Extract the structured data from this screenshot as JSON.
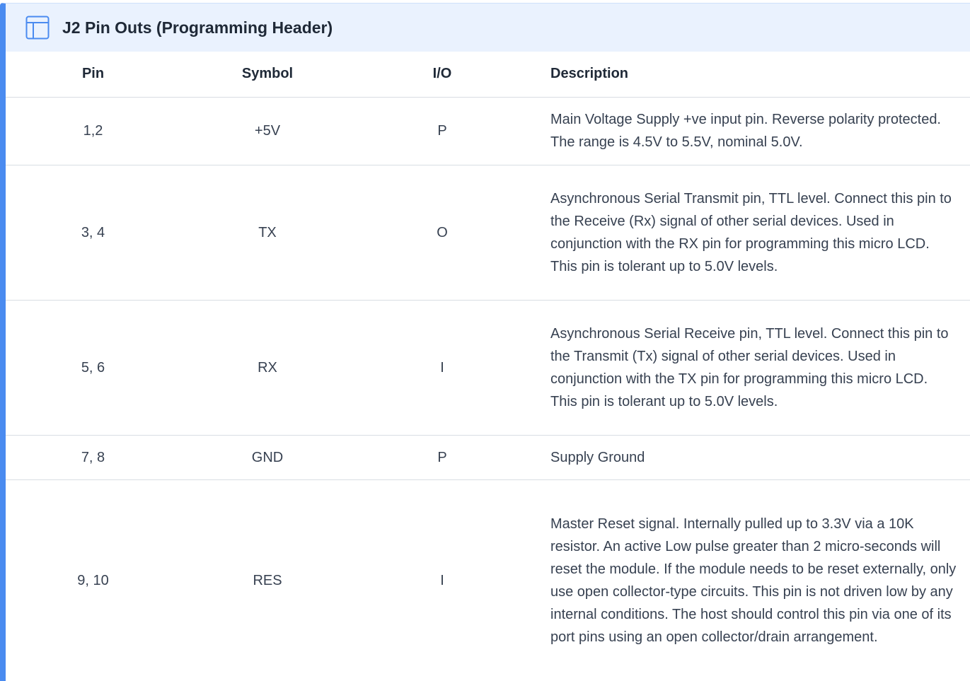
{
  "panel": {
    "title": "J2 Pin Outs (Programming Header)",
    "icon": "table-icon",
    "accent_color": "#4a8bf0",
    "header_bg": "#eaf2fe"
  },
  "table": {
    "headers": {
      "pin": "Pin",
      "symbol": "Symbol",
      "io": "I/O",
      "description": "Description"
    },
    "rows": [
      {
        "pin": "1,2",
        "symbol": "+5V",
        "io": "P",
        "description": "Main Voltage Supply +ve input pin. Reverse polarity protected. The range is 4.5V to 5.5V, nominal 5.0V."
      },
      {
        "pin": "3, 4",
        "symbol": "TX",
        "io": "O",
        "description": "Asynchronous Serial Transmit pin, TTL level. Connect this pin to the Receive (Rx) signal of other serial devices. Used in conjunction with the RX pin for programming this micro LCD. This pin is tolerant up to 5.0V levels."
      },
      {
        "pin": "5, 6",
        "symbol": "RX",
        "io": "I",
        "description": "Asynchronous Serial Receive pin, TTL level. Connect this pin to the Transmit (Tx) signal of other serial devices. Used in conjunction with the TX pin for programming this micro LCD. This pin is tolerant up to 5.0V levels."
      },
      {
        "pin": "7, 8",
        "symbol": "GND",
        "io": "P",
        "description": "Supply Ground"
      },
      {
        "pin": "9, 10",
        "symbol": "RES",
        "io": "I",
        "description": "Master Reset signal. Internally pulled up to 3.3V via a 10K resistor. An active Low pulse greater than 2 micro-seconds will reset the module. If the module needs to be reset externally, only use open collector-type circuits. This pin is not driven low by any internal conditions. The host should control this pin via one of its port pins using an open collector/drain arrangement."
      }
    ]
  }
}
